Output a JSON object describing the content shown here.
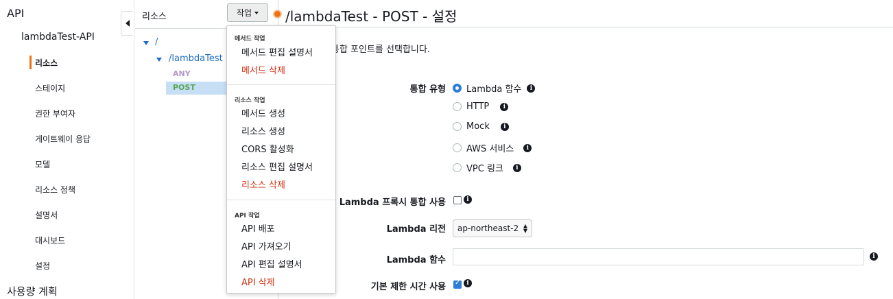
{
  "nav": {
    "api_title": "API",
    "api_name": "lambdaTest-API",
    "items": [
      "리소스",
      "스테이지",
      "권한 부여자",
      "게이트웨이 응답",
      "모델",
      "리소스 정책",
      "설명서",
      "대시보드",
      "설정"
    ],
    "usage_plans": "사용량 계획",
    "accent_color": "#ec7211"
  },
  "resources": {
    "label": "리소스",
    "actions_label": "작업",
    "tree": {
      "root": "/",
      "child": "/lambdaTest",
      "methods": [
        "ANY",
        "POST"
      ]
    }
  },
  "dropdown": {
    "sections": [
      {
        "title": "메서드 작업",
        "items": [
          {
            "label": "메서드 편집 설명서"
          },
          {
            "label": "메서드 삭제",
            "danger": true
          }
        ]
      },
      {
        "title": "리소스 작업",
        "items": [
          {
            "label": "메서드 생성"
          },
          {
            "label": "리소스 생성"
          },
          {
            "label": "CORS 활성화"
          },
          {
            "label": "리소스 편집 설명서"
          },
          {
            "label": "리소스 삭제",
            "danger": true
          }
        ]
      },
      {
        "title": "API 작업",
        "items": [
          {
            "label": "API 배포"
          },
          {
            "label": "API 가져오기"
          },
          {
            "label": "API 편집 설명서"
          },
          {
            "label": "API 삭제",
            "danger": true
          }
        ]
      }
    ]
  },
  "main": {
    "title": "/lambdaTest - POST - 설정",
    "instruction": "통합 포인트를 선택합니다.",
    "integration_type_label": "통합 유형",
    "integration_types": [
      {
        "label": "Lambda 함수",
        "checked": true
      },
      {
        "label": "HTTP",
        "checked": false
      },
      {
        "label": "Mock",
        "checked": false
      },
      {
        "label": "AWS 서비스",
        "checked": false
      },
      {
        "label": "VPC 링크",
        "checked": false
      }
    ],
    "proxy_label": "Lambda 프록시 통합 사용",
    "proxy_checked": false,
    "region_label": "Lambda 리전",
    "region_value": "ap-northeast-2",
    "function_label": "Lambda 함수",
    "function_value": "",
    "timeout_label": "기본 제한 시간 사용",
    "timeout_checked": true
  }
}
